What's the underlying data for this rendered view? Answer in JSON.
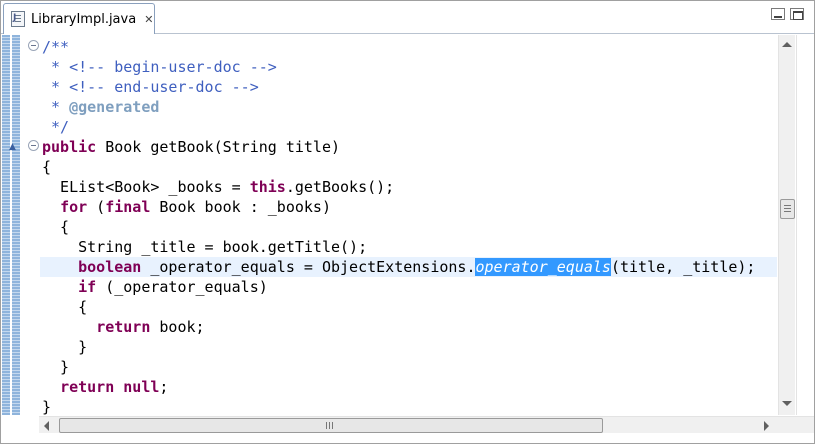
{
  "tab": {
    "icon": "java-file-icon",
    "label": "LibraryImpl.java",
    "close": "✕"
  },
  "colors": {
    "keyword": "#7f0055",
    "comment": "#3f5fbf",
    "annotation_tag": "#7f9fbf",
    "selection": "#3399ff",
    "current_line": "#e8f2fe"
  },
  "code": {
    "lines": [
      [
        {
          "t": "/**",
          "s": "c"
        }
      ],
      [
        {
          "t": " * <!-- begin-user-doc -->",
          "s": "c"
        }
      ],
      [
        {
          "t": " * <!-- end-user-doc -->",
          "s": "c"
        }
      ],
      [
        {
          "t": " * ",
          "s": "c"
        },
        {
          "t": "@generated",
          "s": "ann"
        }
      ],
      [
        {
          "t": " */",
          "s": "c"
        }
      ],
      [
        {
          "t": "public",
          "s": "k"
        },
        {
          "t": " Book getBook(String title)",
          "s": ""
        }
      ],
      [
        {
          "t": "{",
          "s": ""
        }
      ],
      [
        {
          "t": "  EList<Book> _books = ",
          "s": ""
        },
        {
          "t": "this",
          "s": "k"
        },
        {
          "t": ".getBooks();",
          "s": ""
        }
      ],
      [
        {
          "t": "  ",
          "s": ""
        },
        {
          "t": "for",
          "s": "k"
        },
        {
          "t": " (",
          "s": ""
        },
        {
          "t": "final",
          "s": "k"
        },
        {
          "t": " Book book : _books)",
          "s": ""
        }
      ],
      [
        {
          "t": "  {",
          "s": ""
        }
      ],
      [
        {
          "t": "    String _title = book.getTitle();",
          "s": ""
        }
      ],
      [
        {
          "t": "    ",
          "s": ""
        },
        {
          "t": "boolean",
          "s": "k"
        },
        {
          "t": " _operator_equals = ObjectExtensions.",
          "s": ""
        },
        {
          "t": "operator_equals",
          "s": "sel"
        },
        {
          "t": "(title, _title);",
          "s": ""
        }
      ],
      [
        {
          "t": "    ",
          "s": ""
        },
        {
          "t": "if",
          "s": "k"
        },
        {
          "t": " (_operator_equals)",
          "s": ""
        }
      ],
      [
        {
          "t": "    {",
          "s": ""
        }
      ],
      [
        {
          "t": "      ",
          "s": ""
        },
        {
          "t": "return",
          "s": "k"
        },
        {
          "t": " book;",
          "s": ""
        }
      ],
      [
        {
          "t": "    }",
          "s": ""
        }
      ],
      [
        {
          "t": "  }",
          "s": ""
        }
      ],
      [
        {
          "t": "  ",
          "s": ""
        },
        {
          "t": "return",
          "s": "k"
        },
        {
          "t": " ",
          "s": ""
        },
        {
          "t": "null",
          "s": "k"
        },
        {
          "t": ";",
          "s": ""
        }
      ],
      [
        {
          "t": "}",
          "s": ""
        }
      ]
    ]
  }
}
